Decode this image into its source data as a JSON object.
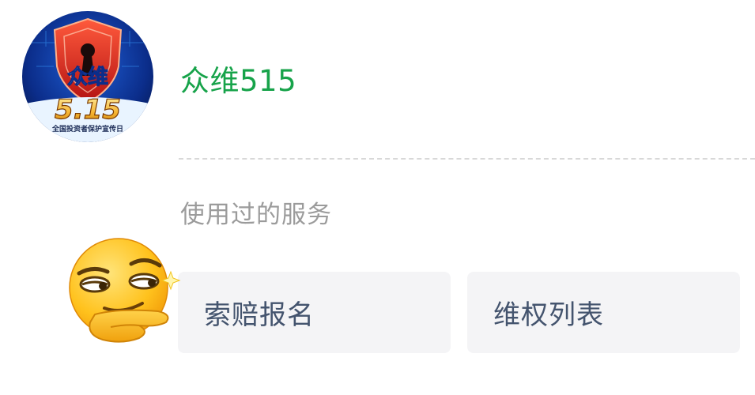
{
  "account": {
    "name": "众维515",
    "avatar": {
      "headline": "众维",
      "date_mark": "5.15",
      "caption": "全国投资者保护宣传日"
    }
  },
  "services": {
    "title": "使用过的服务",
    "items": [
      {
        "label": "索赔报名"
      },
      {
        "label": "维权列表"
      }
    ]
  },
  "colors": {
    "name": "#17a34a",
    "section_title": "#9b9b9b",
    "card_bg": "#f4f4f6",
    "card_text": "#44546e"
  },
  "icons": {
    "avatar": "shield-keyhole-logo",
    "sticker": "smirk-thinking-emoji"
  }
}
